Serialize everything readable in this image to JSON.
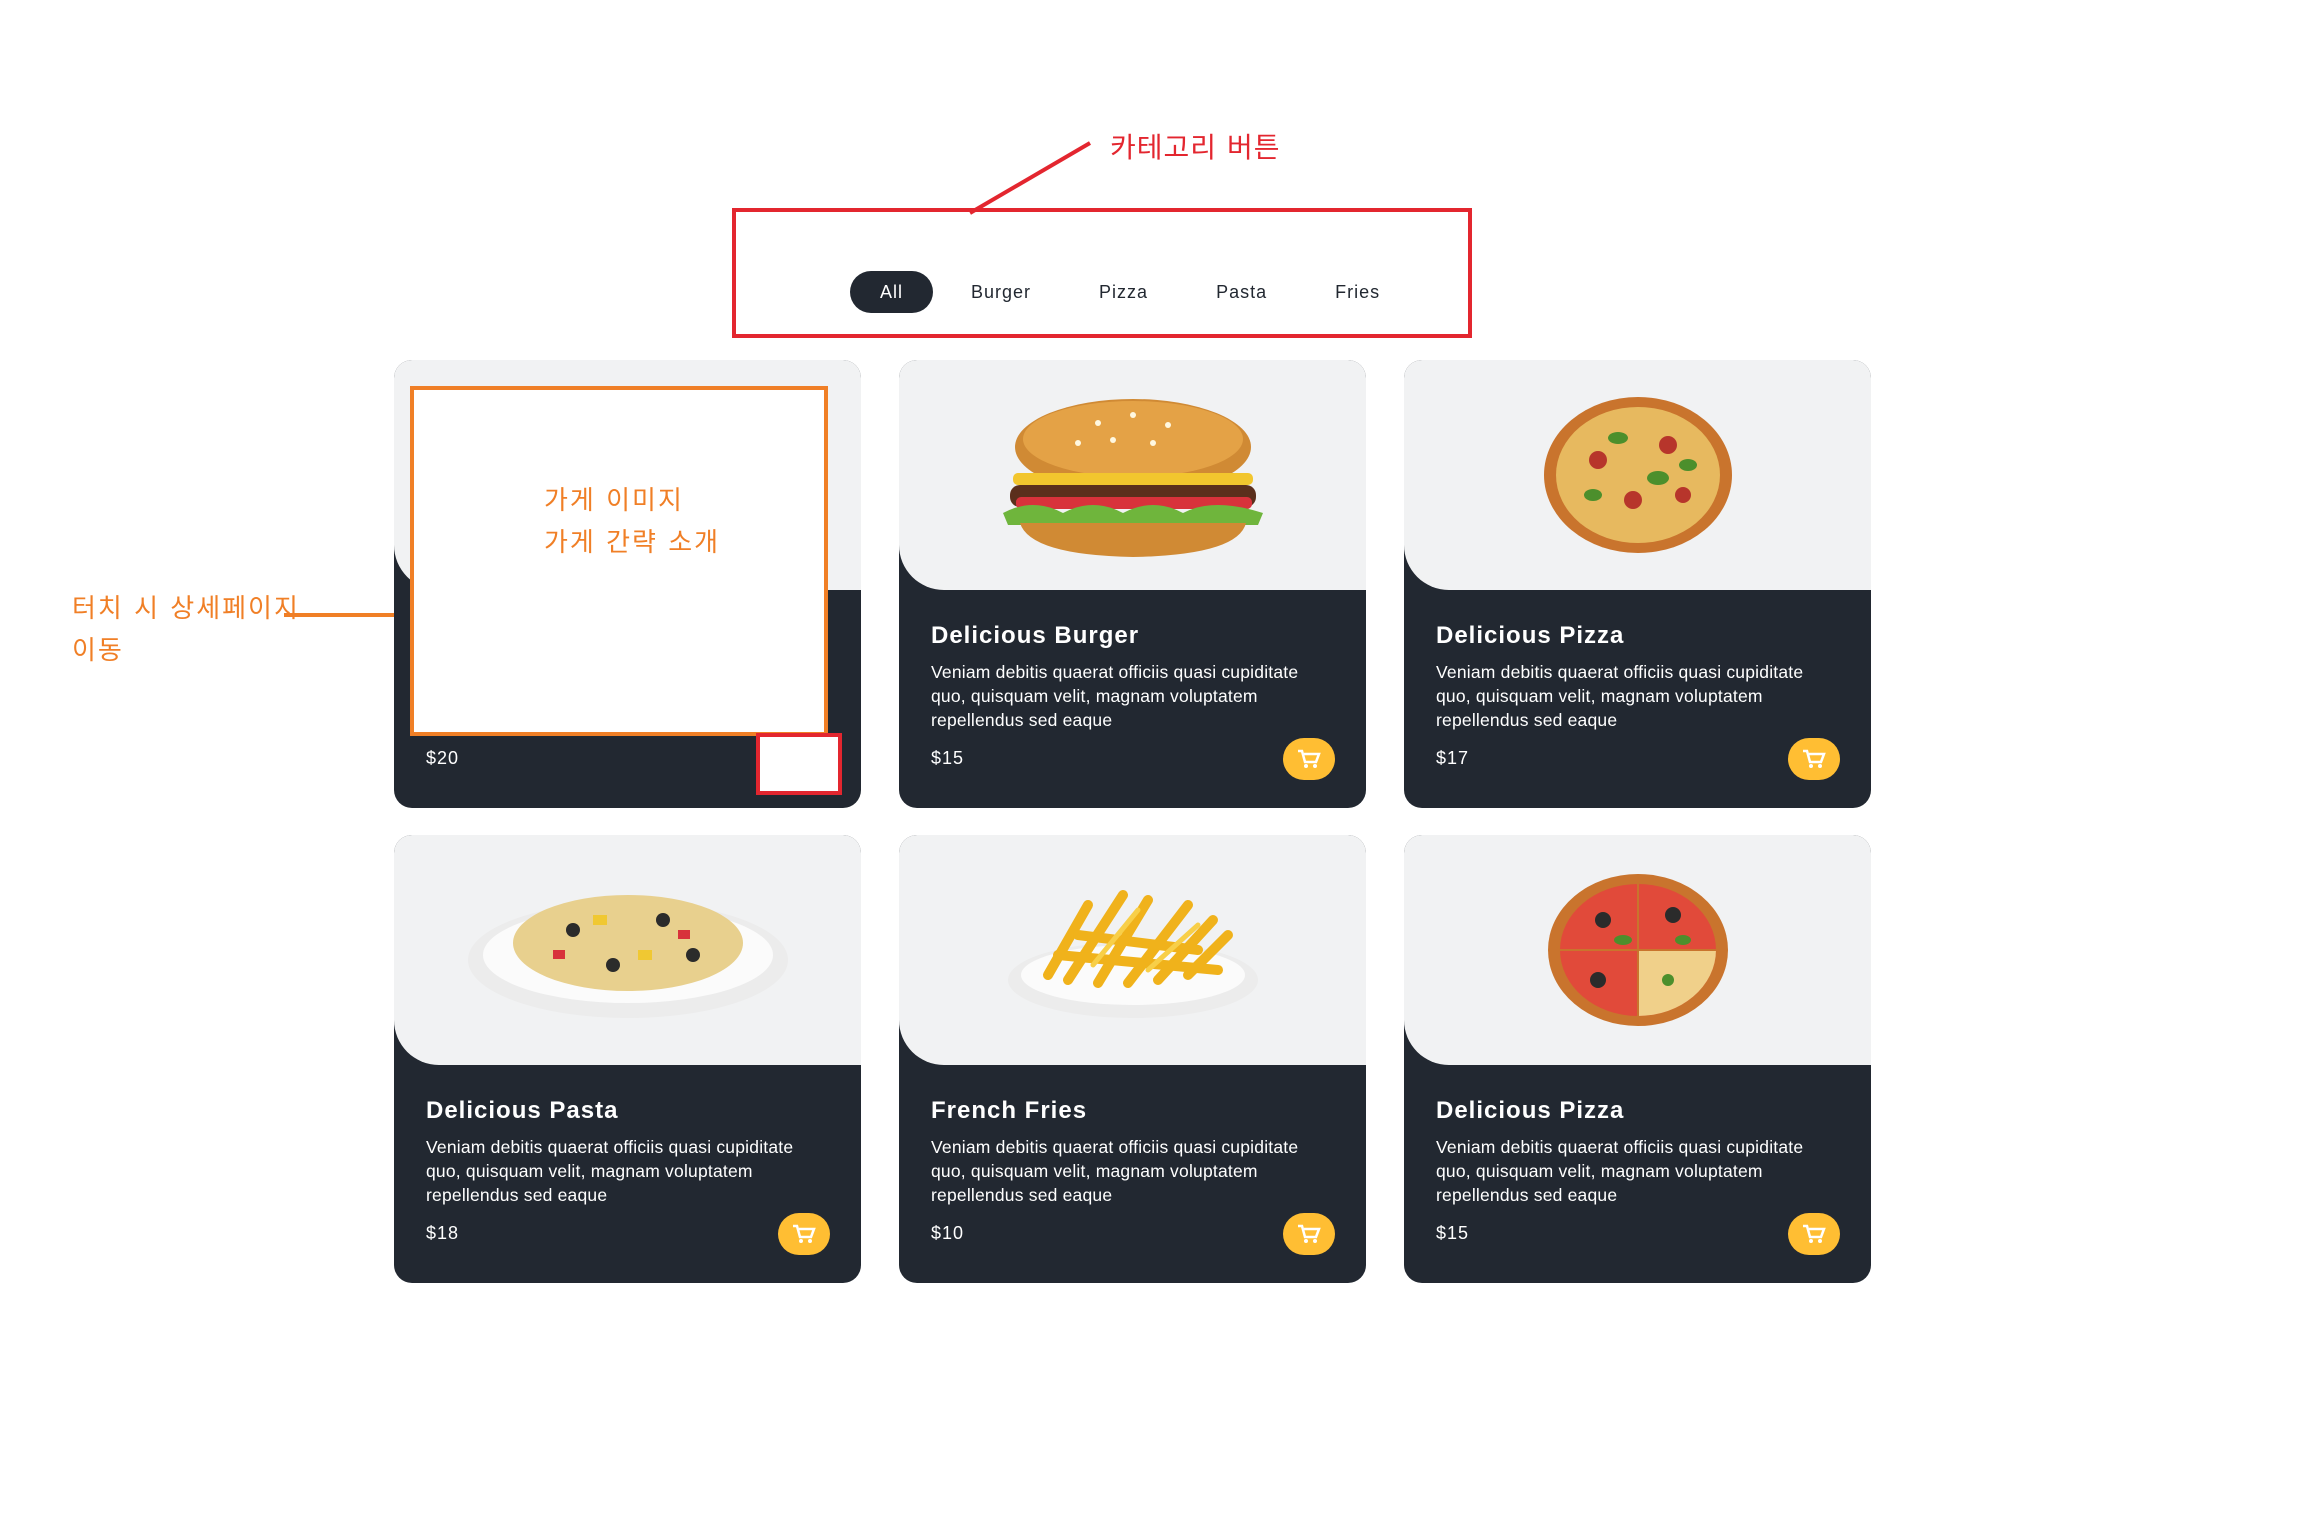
{
  "annotations": {
    "category_note": "카테고리 버튼",
    "image_line1": "가게 이미지",
    "image_line2": "가게 간략 소개",
    "touch_line1": "터치 시 상세페이지",
    "touch_line2": "이동"
  },
  "colors": {
    "dark": "#222831",
    "accent": "#ffbe33",
    "annotation_red": "#e3262f",
    "annotation_orange": "#f07f26",
    "image_bg": "#f1f2f3"
  },
  "tabs": [
    {
      "label": "All",
      "active": true
    },
    {
      "label": "Burger",
      "active": false
    },
    {
      "label": "Pizza",
      "active": false
    },
    {
      "label": "Pasta",
      "active": false
    },
    {
      "label": "Fries",
      "active": false
    }
  ],
  "cards": [
    {
      "title": "",
      "description": "",
      "price": "$20",
      "image": "placeholder",
      "cart_icon": "cart-icon"
    },
    {
      "title": "Delicious Burger",
      "description": "Veniam debitis quaerat officiis quasi cupiditate quo, quisquam velit, magnam voluptatem repellendus sed eaque",
      "price": "$15",
      "image": "burger-image",
      "cart_icon": "cart-icon"
    },
    {
      "title": "Delicious Pizza",
      "description": "Veniam debitis quaerat officiis quasi cupiditate quo, quisquam velit, magnam voluptatem repellendus sed eaque",
      "price": "$17",
      "image": "pizza-image",
      "cart_icon": "cart-icon"
    },
    {
      "title": "Delicious Pasta",
      "description": "Veniam debitis quaerat officiis quasi cupiditate quo, quisquam velit, magnam voluptatem repellendus sed eaque",
      "price": "$18",
      "image": "pasta-image",
      "cart_icon": "cart-icon"
    },
    {
      "title": "French Fries",
      "description": "Veniam debitis quaerat officiis quasi cupiditate quo, quisquam velit, magnam voluptatem repellendus sed eaque",
      "price": "$10",
      "image": "fries-image",
      "cart_icon": "cart-icon"
    },
    {
      "title": "Delicious Pizza",
      "description": "Veniam debitis quaerat officiis quasi cupiditate quo, quisquam velit, magnam voluptatem repellendus sed eaque",
      "price": "$15",
      "image": "pizza-image",
      "cart_icon": "cart-icon"
    }
  ]
}
